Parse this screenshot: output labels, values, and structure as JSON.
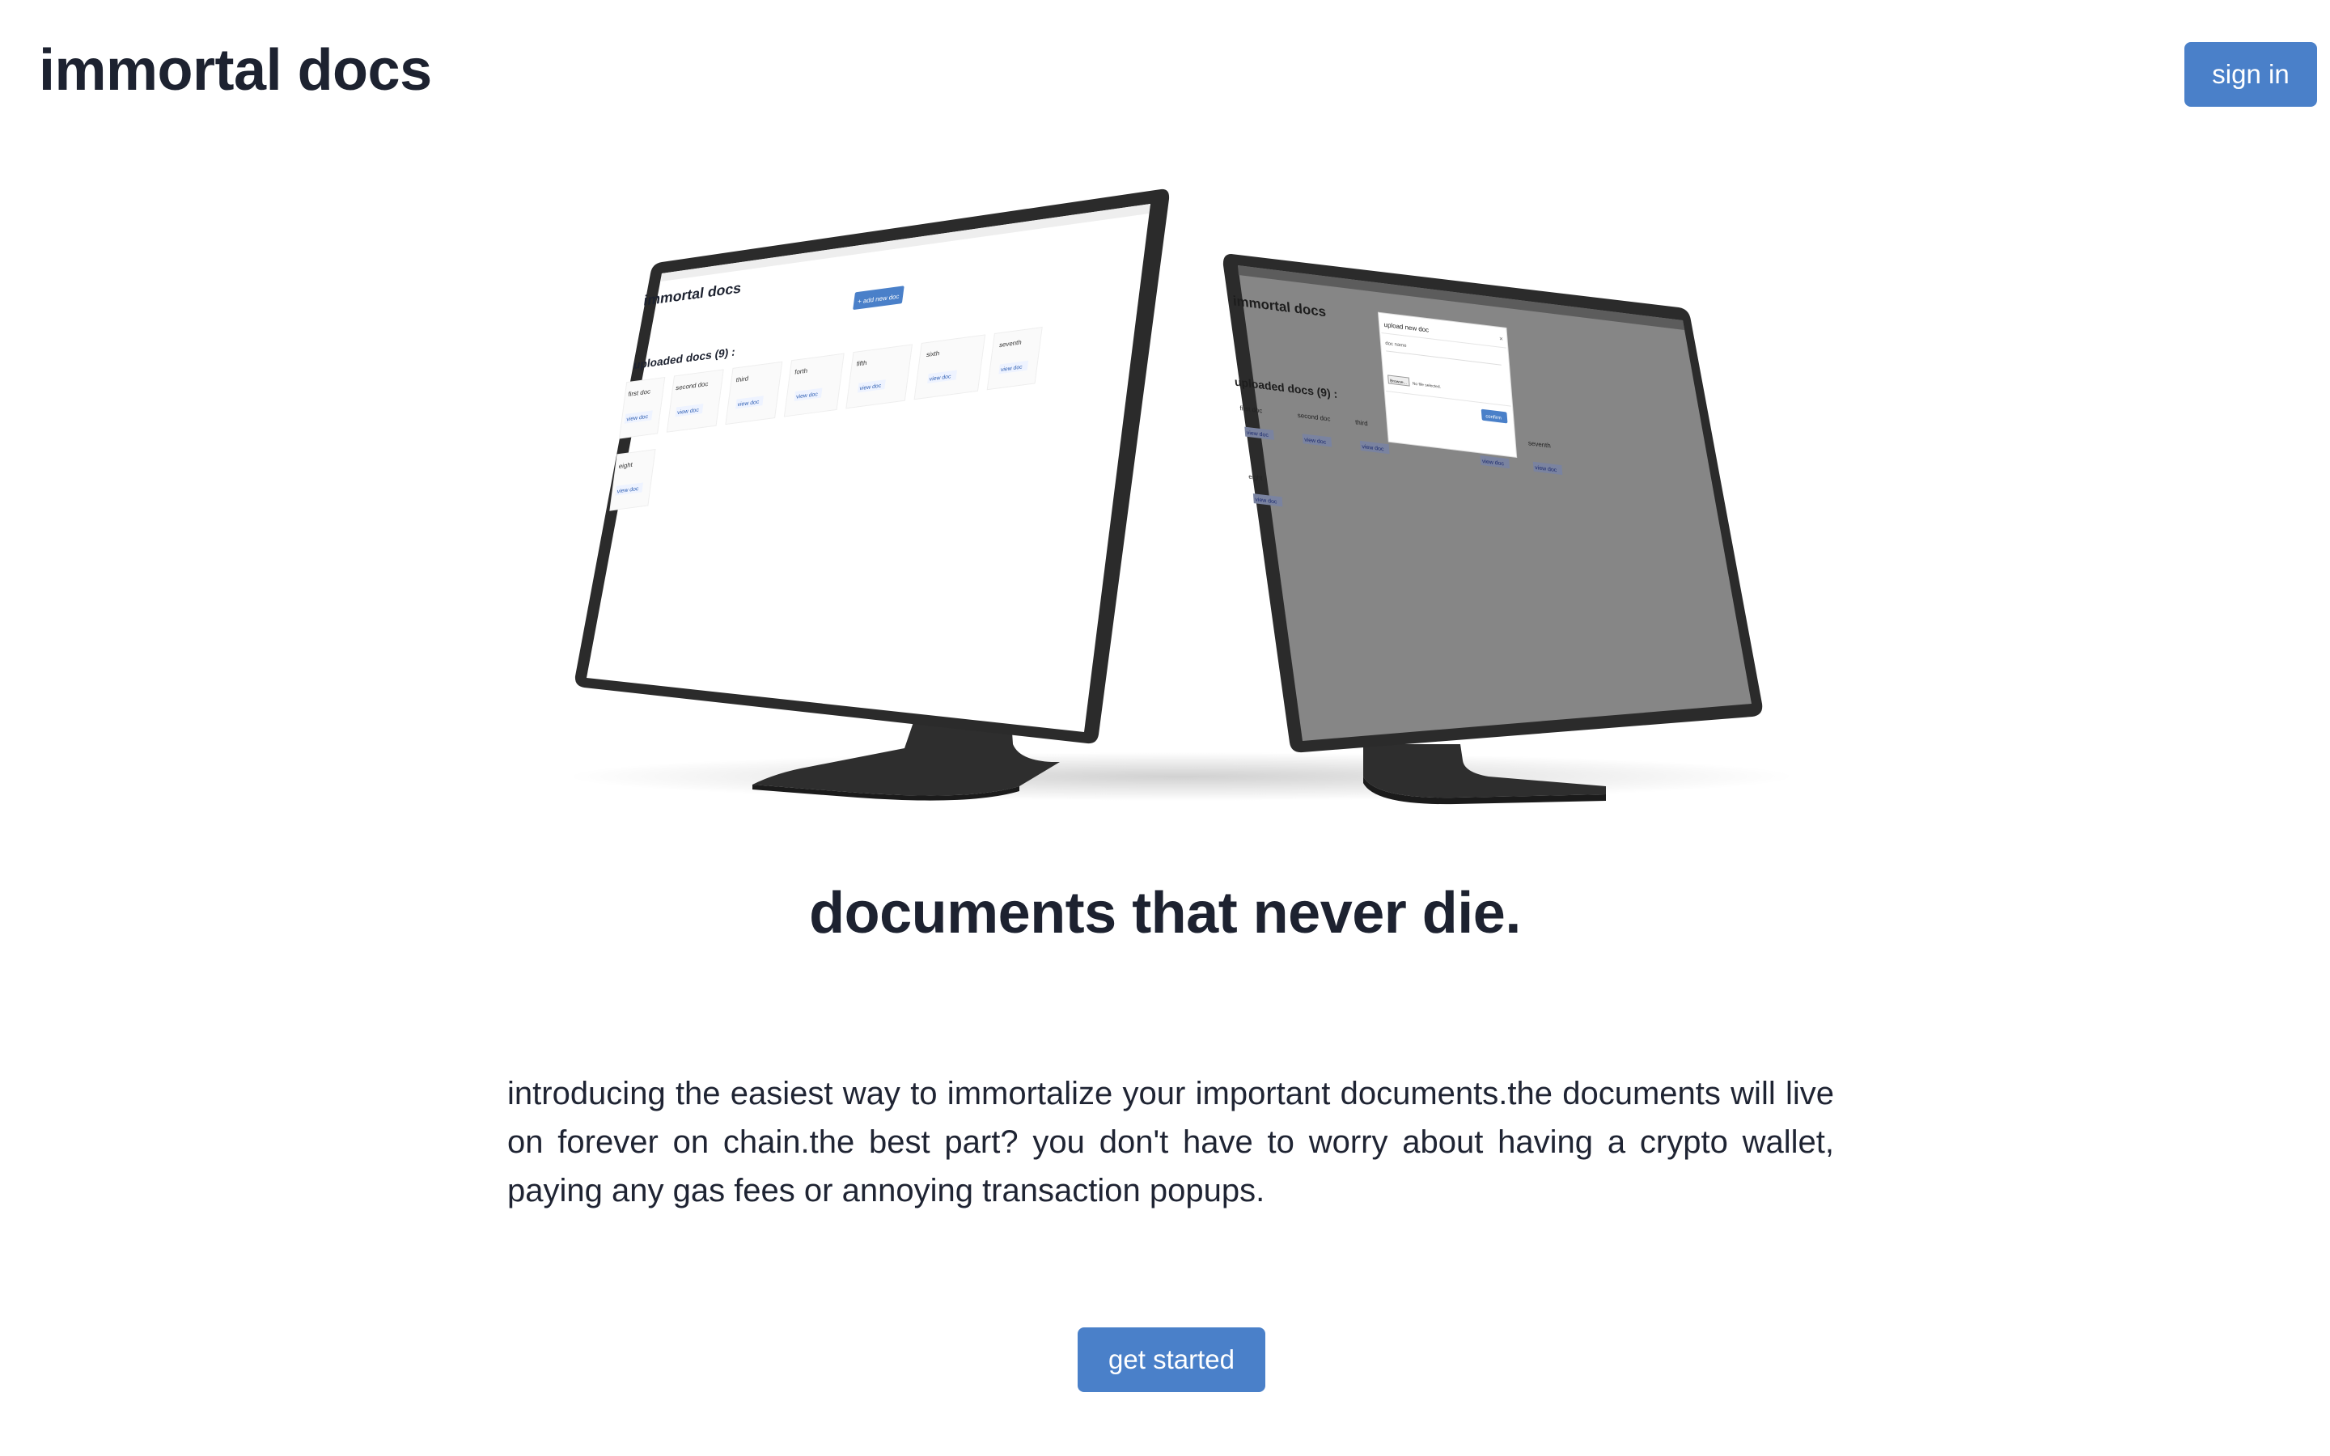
{
  "header": {
    "brand": "immortal docs",
    "signin_label": "sign in"
  },
  "hero": {
    "headline": "documents that never die.",
    "intro": "introducing the easiest way to immortalize your important documents.the documents will live on forever on chain.the best part? you don't have to worry about having a crypto wallet, paying any gas fees or annoying transaction popups.",
    "cta_label": "get started"
  },
  "mockup": {
    "screen_title": "immortal docs",
    "add_button": "+ add new doc",
    "uploaded_heading": "uploaded docs (9) :",
    "view_label": "view doc",
    "docs": [
      "first doc",
      "second doc",
      "third",
      "forth",
      "fifth",
      "sixth",
      "seventh",
      "eight"
    ],
    "modal_title": "upload new doc",
    "modal_field": "doc name",
    "modal_file_button": "Browse...",
    "modal_file_text": "No file selected.",
    "modal_confirm": "confirm"
  },
  "colors": {
    "accent": "#4a80c9",
    "text": "#1d2230",
    "monitor": "#2b2b2b"
  }
}
